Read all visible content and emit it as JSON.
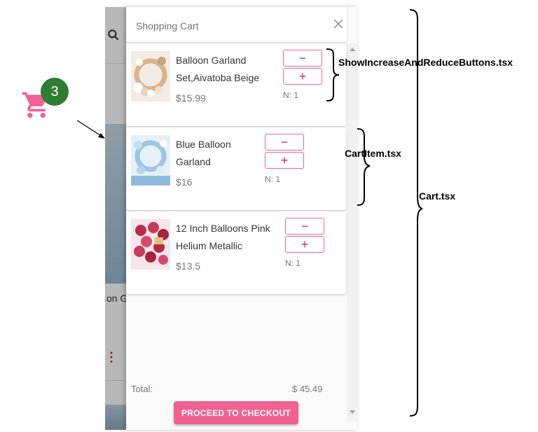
{
  "floating_cart": {
    "icon": "cart-icon",
    "badge_count": "3",
    "badge_color": "#2e7d32",
    "icon_color": "#f06292"
  },
  "background_page": {
    "partial_text": "on G"
  },
  "cart": {
    "title": "Shopping Cart",
    "close_icon": "close-icon",
    "items": [
      {
        "name": "Balloon Garland Set,Aivatoba Beige",
        "price": "$15.99",
        "quantity_label": "N: 1",
        "decrease_label": "−",
        "increase_label": "+"
      },
      {
        "name": "Blue Balloon Garland",
        "price": "$16",
        "quantity_label": "N: 1",
        "decrease_label": "−",
        "increase_label": "+"
      },
      {
        "name": "12 Inch Balloons Pink Helium Metallic",
        "price": "$13.5",
        "quantity_label": "N: 1",
        "decrease_label": "−",
        "increase_label": "+"
      }
    ],
    "total_label": "Total:",
    "total_value": "$ 45.49",
    "checkout_label": "PROCEED TO CHECKOUT",
    "accent_color": "#f06292"
  },
  "annotations": {
    "buttons": "ShowIncreaseAndReduceButtons.tsx",
    "cart_item": "CartItem.tsx",
    "cart": "Cart.tsx"
  }
}
